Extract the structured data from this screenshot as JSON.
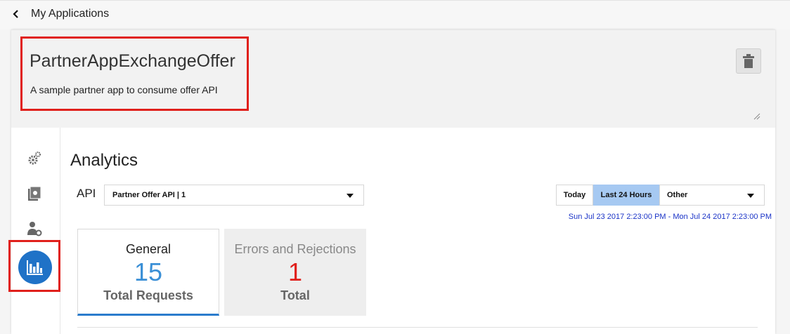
{
  "nav": {
    "back_label": "My Applications"
  },
  "application": {
    "title": "PartnerAppExchangeOffer",
    "description": "A sample partner app to consume offer API"
  },
  "sidebar": {
    "items": [
      {
        "icon": "settings-gears-icon"
      },
      {
        "icon": "api-book-icon"
      },
      {
        "icon": "user-key-icon"
      },
      {
        "icon": "analytics-chart-icon",
        "active": true
      }
    ]
  },
  "analytics": {
    "title": "Analytics",
    "api_label": "API",
    "api_selected": "Partner Offer API | 1",
    "ranges": {
      "today": "Today",
      "last24": "Last 24 Hours",
      "other": "Other"
    },
    "date_range": "Sun Jul 23 2017 2:23:00 PM - Mon Jul 24 2017 2:23:00 PM",
    "tiles": {
      "general": {
        "label": "General",
        "count": "15",
        "sub": "Total Requests"
      },
      "errors": {
        "label": "Errors and Rejections",
        "count": "1",
        "sub": "Total"
      }
    }
  },
  "colors": {
    "accent": "#1f72c7",
    "highlight": "#e0201c",
    "selected_range": "#a6c9f2",
    "error_count": "#e0201c",
    "general_count": "#3a8fd6"
  }
}
